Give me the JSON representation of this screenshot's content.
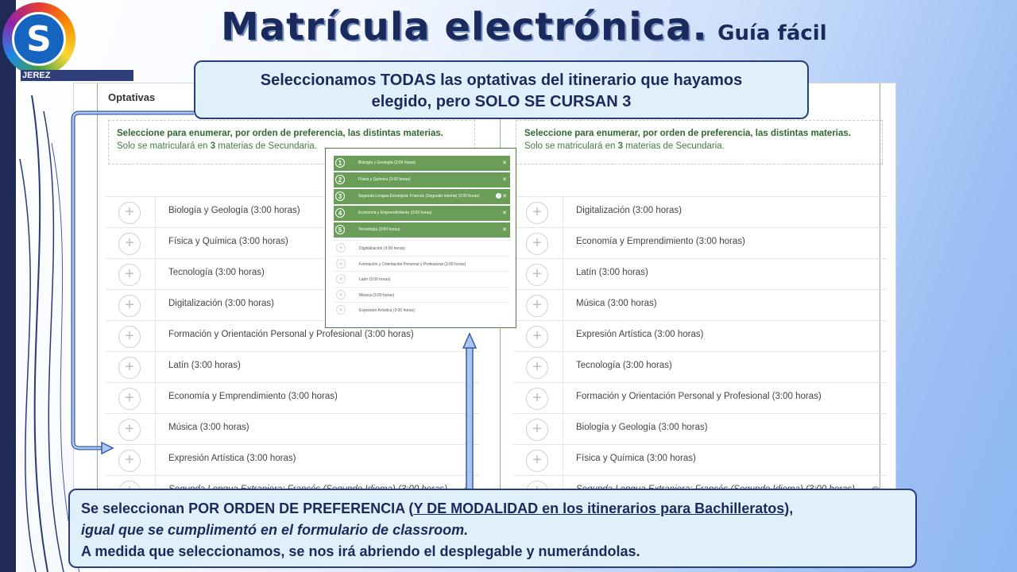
{
  "slide": {
    "title": "Matrícula electrónica.",
    "subtitle": "Guía fácil",
    "logo_letter": "S",
    "logo_tag": "JEREZ"
  },
  "panel": {
    "title": "Optativas",
    "info_line1": "Seleccione para enumerar, por orden de preferencia, las distintas materias.",
    "info_line2_prefix": "Solo se matriculará en ",
    "info_line2_count": "3",
    "info_line2_suffix": " materias de Secundaria.",
    "left_items": [
      "Biología y Geología (3:00 horas)",
      "Física y Química (3:00 horas)",
      "Tecnología (3:00 horas)",
      "Digitalización (3:00 horas)",
      "Formación y Orientación Personal y Profesional (3:00 horas)",
      "Latín (3:00 horas)",
      "Economía y Emprendimiento (3:00 horas)",
      "Música (3:00 horas)",
      "Expresión Artística (3:00 horas)",
      "Segunda Lengua Extranjera: Francés (Segundo Idioma) (3:00 horas)"
    ],
    "right_items": [
      "Digitalización (3:00 horas)",
      "Economía y Emprendimiento (3:00 horas)",
      "Latín (3:00 horas)",
      "Música (3:00 horas)",
      "Expresión Artística (3:00 horas)",
      "Tecnología (3:00 horas)",
      "Formación y Orientación Personal y Profesional (3:00 horas)",
      "Biología y Geología (3:00 horas)",
      "Física y Química (3:00 horas)",
      "Segunda Lengua Extranjera: Francés (Segundo Idioma) (3:00 horas)"
    ]
  },
  "zoom": {
    "selected": [
      {
        "n": "1",
        "label": "Biología y Geología (3:00 horas)"
      },
      {
        "n": "2",
        "label": "Física y Química (3:00 horas)"
      },
      {
        "n": "3",
        "label": "Segunda Lengua Extranjera: Francés (Segundo Idioma) (3:00 horas)"
      },
      {
        "n": "4",
        "label": "Economía y Emprendimiento (3:00 horas)"
      },
      {
        "n": "5",
        "label": "Tecnología (3:00 horas)"
      }
    ],
    "unselected": [
      "Digitalización (3:00 horas)",
      "Formación y Orientación Personal y Profesional (3:00 horas)",
      "Latín (3:00 horas)",
      "Música (3:00 horas)",
      "Expresión Artística (3:00 horas)"
    ]
  },
  "callout_top": {
    "line1": "Seleccionamos TODAS las optativas del itinerario que hayamos",
    "line2": "elegido, pero SOLO SE CURSAN 3"
  },
  "callout_bottom": {
    "part1": "Se seleccionan  POR ORDEN DE PREFERENCIA (",
    "part2_underlined": "Y DE MODALIDAD en los itinerarios para Bachilleratos",
    "part3": "),",
    "line2_italic": "igual que se cumplimentó en el formulario de classroom.",
    "line3": "A medida que seleccionamos,  se nos irá abriendo el desplegable  y numerándolas."
  }
}
